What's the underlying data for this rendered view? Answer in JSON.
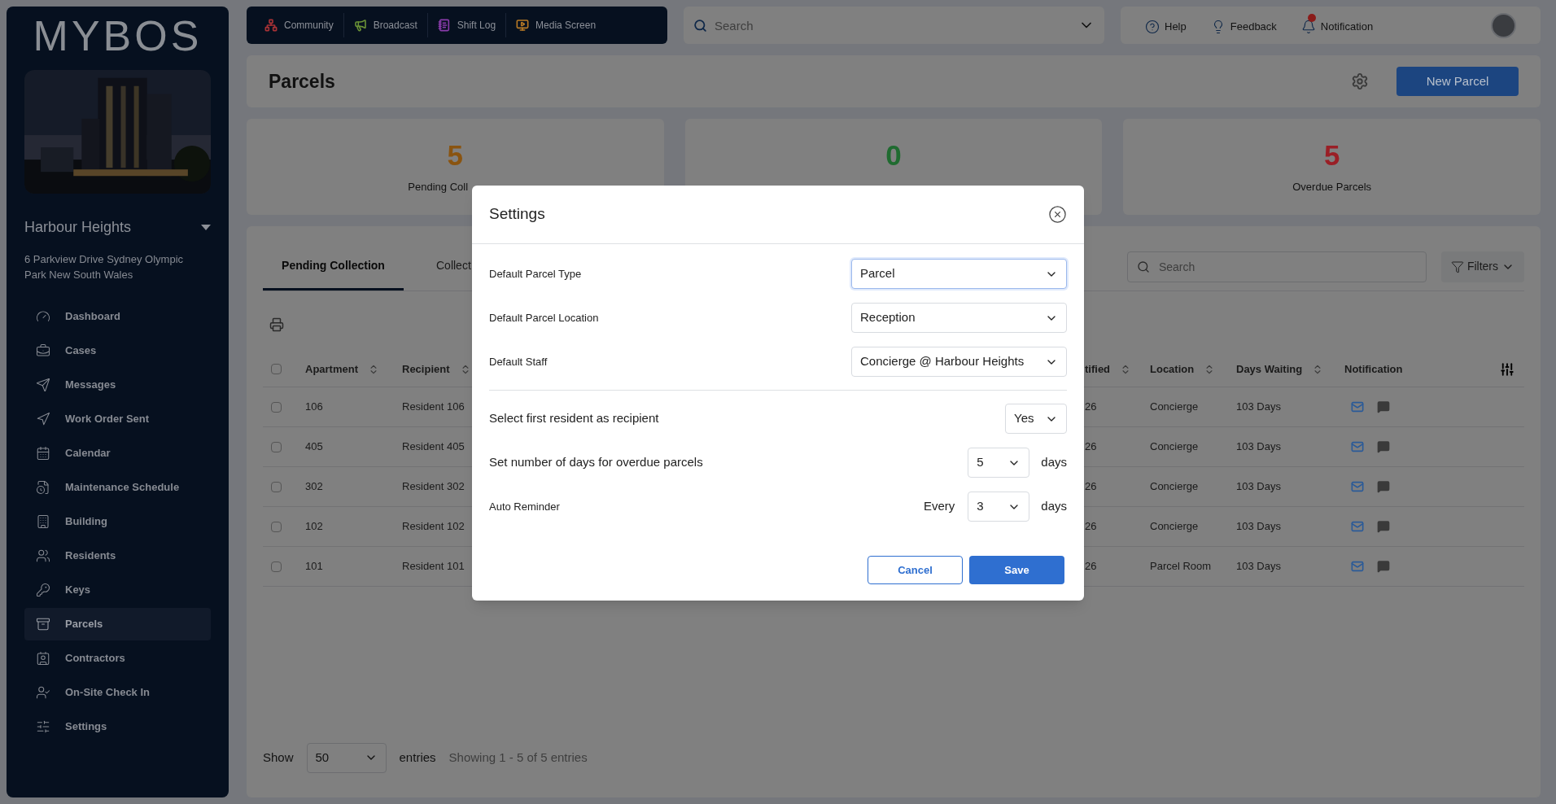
{
  "sidebar": {
    "logo": "MYBOS",
    "property": "Harbour Heights",
    "address": "6 Parkview Drive Sydney Olympic Park New South Wales",
    "items": [
      {
        "label": "Dashboard",
        "selected": false
      },
      {
        "label": "Cases",
        "selected": false
      },
      {
        "label": "Messages",
        "selected": false
      },
      {
        "label": "Work Order Sent",
        "selected": false
      },
      {
        "label": "Calendar",
        "selected": false
      },
      {
        "label": "Maintenance Schedule",
        "selected": false
      },
      {
        "label": "Building",
        "selected": false
      },
      {
        "label": "Residents",
        "selected": false
      },
      {
        "label": "Keys",
        "selected": false
      },
      {
        "label": "Parcels",
        "selected": true
      },
      {
        "label": "Contractors",
        "selected": false
      },
      {
        "label": "On-Site Check In",
        "selected": false
      },
      {
        "label": "Settings",
        "selected": false
      }
    ]
  },
  "quick_links": [
    {
      "label": "Community",
      "color": "#a83236"
    },
    {
      "label": "Broadcast",
      "color": "#6a9236"
    },
    {
      "label": "Shift Log",
      "color": "#8a3cab"
    },
    {
      "label": "Media Screen",
      "color": "#b87a26"
    }
  ],
  "top_search": {
    "placeholder": "Search"
  },
  "header_links": [
    {
      "label": "Help",
      "alert": false
    },
    {
      "label": "Feedback",
      "alert": false
    },
    {
      "label": "Notification",
      "alert": true
    }
  ],
  "page": {
    "title": "Parcels",
    "new_button": "New Parcel"
  },
  "stats": [
    {
      "value": "5",
      "label": "Pending Coll",
      "color": "#8a5410"
    },
    {
      "value": "0",
      "color": "#1f6b30"
    },
    {
      "value": "5",
      "label": "Overdue Parcels",
      "color": "#9a1f26"
    }
  ],
  "tabs": [
    {
      "label": "Pending Collection",
      "selected": true
    },
    {
      "label": "Collect",
      "selected": false
    }
  ],
  "table_search": {
    "placeholder": "Search"
  },
  "filters": "Filters",
  "table": {
    "all_checked": false,
    "columns": [
      {
        "label": "Apartment",
        "sortable": true
      },
      {
        "label": "Recipient",
        "sortable": true
      },
      {
        "label": "tified",
        "sortable": true
      },
      {
        "label": "Location",
        "sortable": true
      },
      {
        "label": "Days Waiting",
        "sortable": true
      },
      {
        "label": "Notification",
        "sortable": false
      }
    ],
    "rows": [
      {
        "checked": false,
        "cells": [
          "106",
          "Resident 106",
          "26",
          "Concierge",
          "103 Days"
        ],
        "email": true,
        "sms": false
      },
      {
        "checked": false,
        "cells": [
          "405",
          "Resident 405",
          "26",
          "Concierge",
          "103 Days"
        ],
        "email": true,
        "sms": false
      },
      {
        "checked": false,
        "cells": [
          "302",
          "Resident 302",
          "26",
          "Concierge",
          "103 Days"
        ],
        "email": true,
        "sms": false
      },
      {
        "checked": false,
        "cells": [
          "102",
          "Resident 102",
          "26",
          "Concierge",
          "103 Days"
        ],
        "email": true,
        "sms": false
      },
      {
        "checked": false,
        "cells": [
          "101",
          "Resident 101",
          "26",
          "Parcel Room",
          "103 Days"
        ],
        "email": true,
        "sms": false
      }
    ]
  },
  "pagination": {
    "show": "Show",
    "page_size": "50",
    "entries": "entries",
    "summary": "Showing 1 - 5 of 5 entries"
  },
  "modal": {
    "title": "Settings",
    "defaults": [
      {
        "label": "Default Parcel Type",
        "value": "Parcel",
        "focused": true
      },
      {
        "label": "Default Parcel Location",
        "value": "Reception",
        "focused": false
      },
      {
        "label": "Default Staff",
        "value": "Concierge @ Harbour Heights",
        "focused": false
      }
    ],
    "options": [
      {
        "kind": "plain",
        "label": "Select first resident as recipient",
        "value": "Yes"
      },
      {
        "kind": "days",
        "label": "Set number of days for overdue parcels",
        "value": "5",
        "suffix": "days"
      },
      {
        "kind": "reminder",
        "label": "Auto Reminder",
        "prefix": "Every",
        "value": "3",
        "suffix": "days"
      }
    ],
    "cancel": "Cancel",
    "save": "Save"
  }
}
